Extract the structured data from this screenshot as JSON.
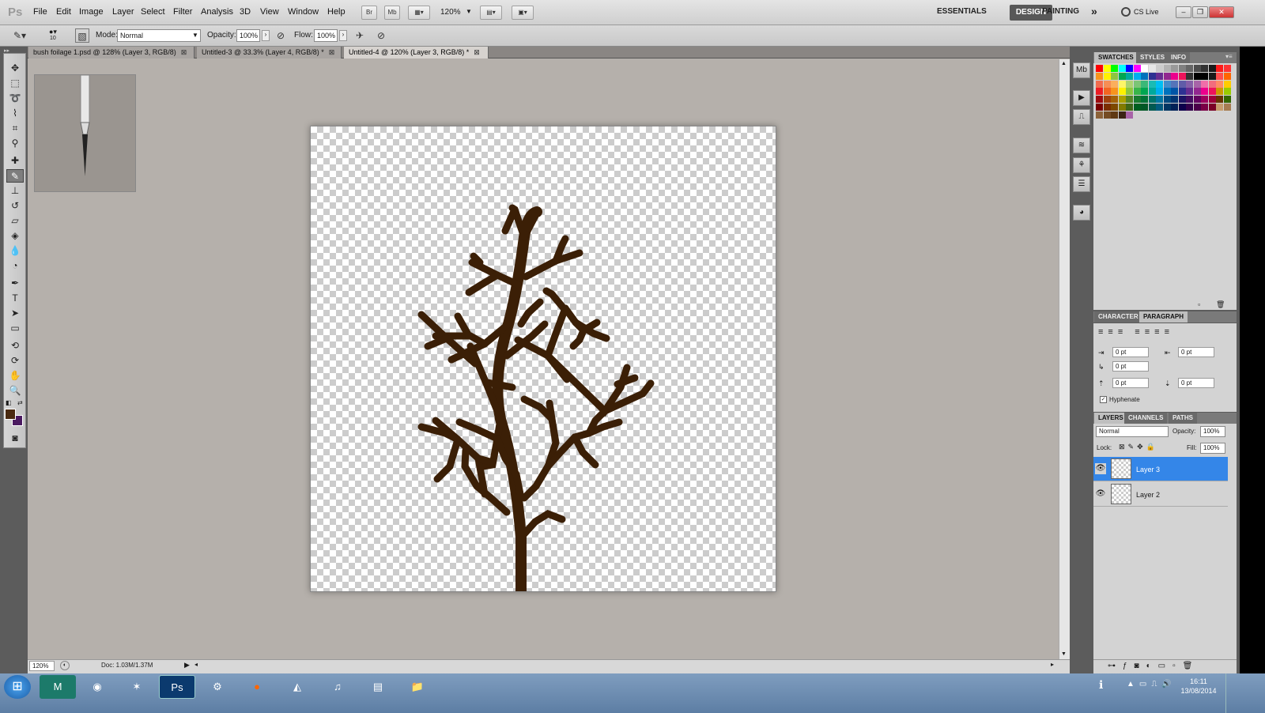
{
  "app": {
    "logo": "Ps"
  },
  "menu": [
    "File",
    "Edit",
    "Image",
    "Layer",
    "Select",
    "Filter",
    "Analysis",
    "3D",
    "View",
    "Window",
    "Help"
  ],
  "appbar": {
    "br_label": "Br",
    "mb_label": "Mb",
    "zoom": "120%"
  },
  "workspaces": {
    "essentials": "ESSENTIALS",
    "design": "DESIGN",
    "painting": "PAINTING",
    "more": "»",
    "cslive": "CS Live"
  },
  "options": {
    "brush_size": "10",
    "mode_label": "Mode:",
    "mode_value": "Normal",
    "opacity_label": "Opacity:",
    "opacity_value": "100%",
    "flow_label": "Flow:",
    "flow_value": "100%"
  },
  "doc_tabs": [
    {
      "label": "bush foilage 1.psd @ 128% (Layer 3, RGB/8)"
    },
    {
      "label": "Untitled-3 @ 33.3% (Layer 4, RGB/8) *"
    },
    {
      "label": "Untitled-4 @ 120% (Layer 3, RGB/8) *"
    }
  ],
  "status": {
    "zoom": "120%",
    "doc": "Doc: 1.03M/1.37M"
  },
  "panels": {
    "swatches_tabs": [
      "SWATCHES",
      "STYLES",
      "INFO"
    ],
    "char_tabs": [
      "CHARACTER",
      "PARAGRAPH"
    ],
    "layers_tabs": [
      "LAYERS",
      "CHANNELS",
      "PATHS"
    ]
  },
  "paragraph": {
    "indent_left": "0 pt",
    "indent_right": "0 pt",
    "first_line": "0 pt",
    "space_before": "0 pt",
    "space_after": "0 pt",
    "hyphenate": "Hyphenate"
  },
  "layers": {
    "blend_mode": "Normal",
    "opacity_label": "Opacity:",
    "opacity": "100%",
    "lock_label": "Lock:",
    "fill_label": "Fill:",
    "fill": "100%",
    "items": [
      {
        "name": "Layer 3",
        "selected": true
      },
      {
        "name": "Layer 2",
        "selected": false
      }
    ]
  },
  "taskbar": {
    "time": "16:11",
    "date": "13/08/2014"
  },
  "colors": {
    "foreground": "#4a2a10",
    "background": "#4a1a60",
    "tree": "#3b1f06",
    "selection": "#3486e8"
  }
}
